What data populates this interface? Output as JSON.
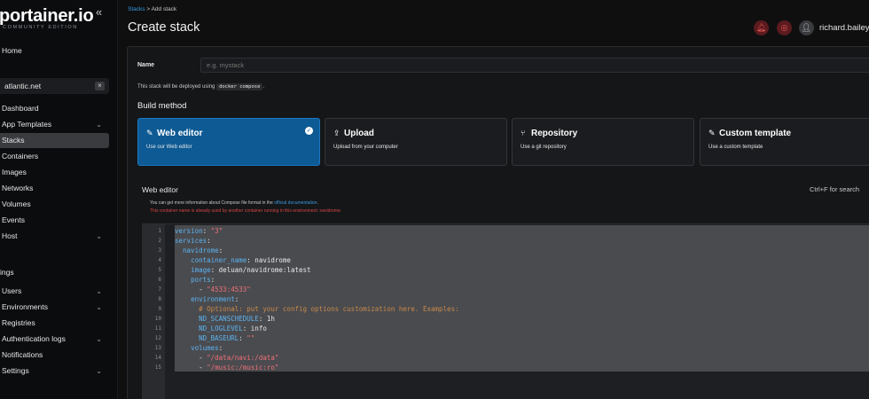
{
  "sidebar": {
    "logo": "portainer.io",
    "logo_sub": "COMMUNITY EDITION",
    "collapse_icon": "«",
    "home": "Home",
    "environment": {
      "name": "atlantic.net",
      "close": "×"
    },
    "items": [
      {
        "label": "Dashboard",
        "chevron": false
      },
      {
        "label": "App Templates",
        "chevron": true
      },
      {
        "label": "Stacks",
        "chevron": false,
        "active": true
      },
      {
        "label": "Containers",
        "chevron": false
      },
      {
        "label": "Images",
        "chevron": false
      },
      {
        "label": "Networks",
        "chevron": false
      },
      {
        "label": "Volumes",
        "chevron": false
      },
      {
        "label": "Events",
        "chevron": false
      },
      {
        "label": "Host",
        "chevron": true
      }
    ],
    "settings_heading": "ings",
    "settings_items": [
      {
        "label": "Users",
        "chevron": true
      },
      {
        "label": "Environments",
        "chevron": true
      },
      {
        "label": "Registries",
        "chevron": false
      },
      {
        "label": "Authentication logs",
        "chevron": true
      },
      {
        "label": "Notifications",
        "chevron": false
      },
      {
        "label": "Settings",
        "chevron": true
      }
    ]
  },
  "header": {
    "breadcrumb_link": "Stacks",
    "breadcrumb_sep": ">",
    "breadcrumb_current": "Add stack",
    "title": "Create stack",
    "username": "richard.bailey"
  },
  "form": {
    "name_label": "Name",
    "name_placeholder": "e.g. mystack",
    "name_value": "",
    "deploy_note_prefix": "This stack will be deployed using",
    "deploy_note_code": "docker compose",
    "deploy_note_suffix": ".",
    "build_method_heading": "Build method"
  },
  "build_methods": [
    {
      "icon": "✎",
      "title": "Web editor",
      "desc": "Use our Web editor",
      "selected": true
    },
    {
      "icon": "⇪",
      "title": "Upload",
      "desc": "Upload from your computer",
      "selected": false
    },
    {
      "icon": "⑂",
      "title": "Repository",
      "desc": "Use a git repository",
      "selected": false
    },
    {
      "icon": "✎",
      "title": "Custom template",
      "desc": "Use a custom template",
      "selected": false
    }
  ],
  "editor": {
    "title": "Web editor",
    "shortcut_hint": "Ctrl+F for search",
    "info_prefix": "You can get more information about Compose file format in the",
    "info_link": "official documentation",
    "info_suffix": ".",
    "warning": "This container name is already used by another container running in this environment: navidrome.",
    "line_numbers": [
      "1",
      "2",
      "3",
      "4",
      "5",
      "6",
      "7",
      "8",
      "9",
      "10",
      "11",
      "12",
      "13",
      "14",
      "15"
    ],
    "lines": [
      [
        [
          "k",
          "version"
        ],
        [
          "p",
          ": "
        ],
        [
          "s",
          "\"3\""
        ]
      ],
      [
        [
          "k",
          "services"
        ],
        [
          "p",
          ":"
        ]
      ],
      [
        [
          "p",
          "  "
        ],
        [
          "k",
          "navidrome"
        ],
        [
          "p",
          ":"
        ]
      ],
      [
        [
          "p",
          "    "
        ],
        [
          "k",
          "container_name"
        ],
        [
          "p",
          ": navidrome"
        ]
      ],
      [
        [
          "p",
          "    "
        ],
        [
          "k",
          "image"
        ],
        [
          "p",
          ": deluan/navidrome:latest"
        ]
      ],
      [
        [
          "p",
          "    "
        ],
        [
          "k",
          "ports"
        ],
        [
          "p",
          ":"
        ]
      ],
      [
        [
          "p",
          "      - "
        ],
        [
          "s",
          "\"4533:4533\""
        ]
      ],
      [
        [
          "p",
          "    "
        ],
        [
          "k",
          "environment"
        ],
        [
          "p",
          ":"
        ]
      ],
      [
        [
          "p",
          "      "
        ],
        [
          "c",
          "# Optional: put your config options customization here. Examples:"
        ]
      ],
      [
        [
          "p",
          "      "
        ],
        [
          "k",
          "ND_SCANSCHEDULE"
        ],
        [
          "p",
          ": 1h"
        ]
      ],
      [
        [
          "p",
          "      "
        ],
        [
          "k",
          "ND_LOGLEVEL"
        ],
        [
          "p",
          ": info"
        ]
      ],
      [
        [
          "p",
          "      "
        ],
        [
          "k",
          "ND_BASEURL"
        ],
        [
          "p",
          ": "
        ],
        [
          "s",
          "\"\""
        ]
      ],
      [
        [
          "p",
          "    "
        ],
        [
          "k",
          "volumes"
        ],
        [
          "p",
          ":"
        ]
      ],
      [
        [
          "p",
          "      - "
        ],
        [
          "s",
          "\"/data/navi:/data\""
        ]
      ],
      [
        [
          "p",
          "      - "
        ],
        [
          "s",
          "\"/music:/music:ro\""
        ]
      ]
    ]
  }
}
